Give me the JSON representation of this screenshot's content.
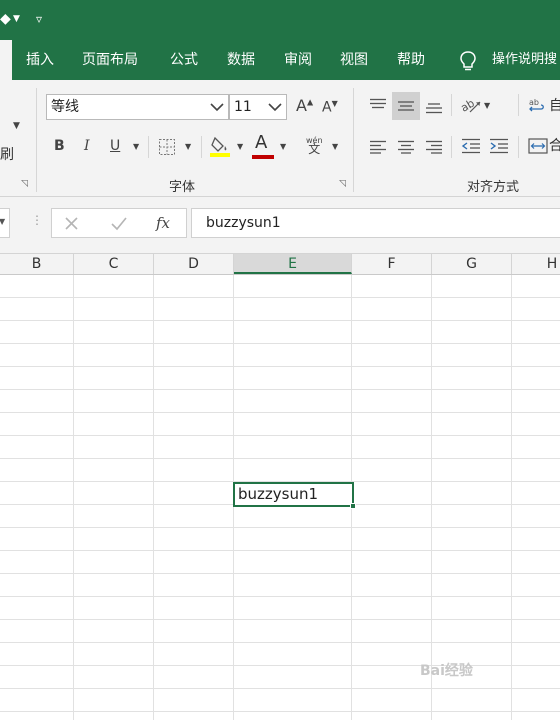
{
  "menu": {
    "items": [
      "插入",
      "页面布局",
      "公式",
      "数据",
      "审阅",
      "视图",
      "帮助"
    ],
    "tell_me": "操作说明搜"
  },
  "ribbon": {
    "clipboard": {
      "format_painter_partial": "刷"
    },
    "font": {
      "group_label": "字体",
      "font_name": "等线",
      "font_size": "11",
      "grow_label": "A",
      "shrink_label": "A",
      "bold_label": "B",
      "italic_label": "I",
      "underline_label": "U",
      "font_color_label": "A",
      "phonetic_top": "wén",
      "phonetic_bottom": "文",
      "fill_color": "#ffff00",
      "font_color": "#c00000"
    },
    "alignment": {
      "group_label": "对齐方式",
      "wrap_partial": "自",
      "merge_partial": "合"
    }
  },
  "formula_bar": {
    "fx_label": "fx",
    "content": "buzzysun1"
  },
  "sheet": {
    "columns": [
      "B",
      "C",
      "D",
      "E",
      "F",
      "G",
      "H"
    ],
    "selected_column": "E",
    "active_cell_value": "buzzysun1"
  },
  "watermark": "Bai经验",
  "colors": {
    "accent": "#217346"
  }
}
